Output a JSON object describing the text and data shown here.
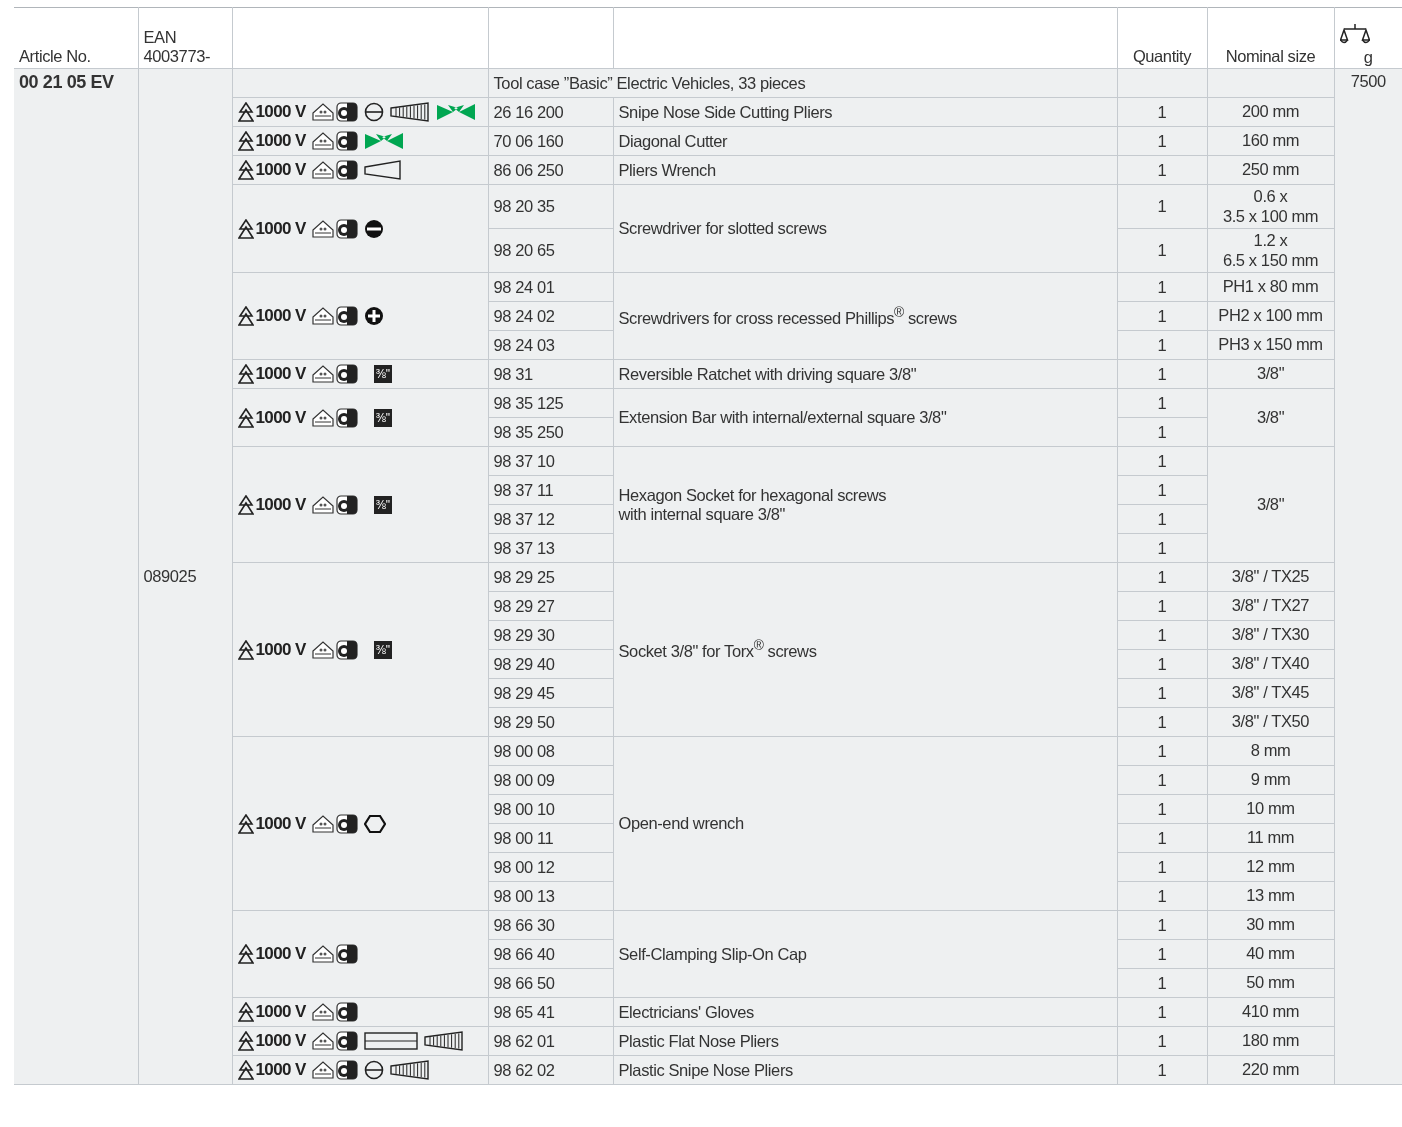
{
  "table": {
    "header": {
      "article_no": "Article No.",
      "ean": "EAN\n4003773-",
      "quantity": "Quantity",
      "nominal_size": "Nominal size",
      "weight_unit": "g"
    },
    "set": {
      "article_no": "00 21 05 EV",
      "ean": "089025",
      "description": "Tool case ”Basic” Electric Vehicles, 33 pieces",
      "weight": "7500"
    },
    "groups": [
      {
        "rating": "1000 V",
        "icons": [
          {
            "kind": "slot"
          },
          {
            "kind": "taper"
          },
          {
            "kind": "cutter"
          }
        ],
        "articles": [
          "26 16 200"
        ],
        "description": "Snipe Nose Side Cutting Pliers",
        "quantities": [
          "1"
        ],
        "sizes": [
          "200 mm"
        ]
      },
      {
        "rating": "1000 V",
        "icons": [
          {
            "kind": "cutter"
          }
        ],
        "articles": [
          "70 06 160"
        ],
        "description": "Diagonal Cutter",
        "quantities": [
          "1"
        ],
        "sizes": [
          "160 mm"
        ]
      },
      {
        "rating": "1000 V",
        "icons": [
          {
            "kind": "jaw"
          }
        ],
        "articles": [
          "86 06 250"
        ],
        "description": "Pliers Wrench",
        "quantities": [
          "1"
        ],
        "sizes": [
          "250 mm"
        ]
      },
      {
        "rating": "1000 V",
        "icons": [
          {
            "kind": "slot-solid"
          }
        ],
        "articles": [
          "98 20 35",
          "98 20 65"
        ],
        "description": "Screwdriver for slotted screws",
        "quantities": [
          "1",
          "1"
        ],
        "sizes": [
          "0.6 x\n3.5 x 100 mm",
          "1.2 x\n6.5 x 150 mm"
        ]
      },
      {
        "rating": "1000 V",
        "icons": [
          {
            "kind": "cross-solid"
          }
        ],
        "articles": [
          "98 24 01",
          "98 24 02",
          "98 24 03"
        ],
        "description": "Screwdrivers for cross recessed Phillips$^{®}$ screws",
        "quantities": [
          "1",
          "1",
          "1"
        ],
        "sizes": [
          "PH1 x 80 mm",
          "PH2 x 100 mm",
          "PH3 x 150 mm"
        ]
      },
      {
        "rating": "1000 V",
        "icons": [
          {
            "kind": "square-drive",
            "label": "⅜\""
          }
        ],
        "articles": [
          "98 31"
        ],
        "description": "Reversible Ratchet with driving square 3/8\"",
        "quantities": [
          "1"
        ],
        "sizes": [
          "3/8\""
        ]
      },
      {
        "rating": "1000 V",
        "icons": [
          {
            "kind": "square-drive",
            "label": "⅜\""
          }
        ],
        "articles": [
          "98 35 125",
          "98 35 250"
        ],
        "description": "Extension Bar with internal/external square 3/8\"",
        "quantities": [
          "1",
          "1"
        ],
        "size": "3/8\""
      },
      {
        "rating": "1000 V",
        "icons": [
          {
            "kind": "square-drive",
            "label": "⅜\""
          }
        ],
        "articles": [
          "98 37 10",
          "98 37 11",
          "98 37 12",
          "98 37 13"
        ],
        "description": "Hexagon Socket for hexagonal screws\nwith internal square 3/8\"",
        "quantities": [
          "1",
          "1",
          "1",
          "1"
        ],
        "size": "3/8\""
      },
      {
        "rating": "1000 V",
        "icons": [
          {
            "kind": "square-drive",
            "label": "⅜\""
          }
        ],
        "articles": [
          "98 29 25",
          "98 29 27",
          "98 29 30",
          "98 29 40",
          "98 29 45",
          "98 29 50"
        ],
        "description": "Socket 3/8\" for Torx$^{®}$ screws",
        "quantities": [
          "1",
          "1",
          "1",
          "1",
          "1",
          "1"
        ],
        "sizes": [
          "3/8\" / TX25",
          "3/8\" / TX27",
          "3/8\" / TX30",
          "3/8\" / TX40",
          "3/8\" / TX45",
          "3/8\" / TX50"
        ]
      },
      {
        "rating": "1000 V",
        "icons": [
          {
            "kind": "hexagon"
          }
        ],
        "articles": [
          "98 00 08",
          "98 00 09",
          "98 00 10",
          "98 00 11",
          "98 00 12",
          "98 00 13"
        ],
        "description": "Open-end wrench",
        "quantities": [
          "1",
          "1",
          "1",
          "1",
          "1",
          "1"
        ],
        "sizes": [
          "8 mm",
          "9 mm",
          "10 mm",
          "11 mm",
          "12 mm",
          "13 mm"
        ]
      },
      {
        "rating": "1000 V",
        "articles": [
          "98 66 30",
          "98 66 40",
          "98 66 50"
        ],
        "description": "Self-Clamping Slip-On Cap",
        "quantities": [
          "1",
          "1",
          "1"
        ],
        "sizes": [
          "30 mm",
          "40 mm",
          "50 mm"
        ]
      },
      {
        "rating": "1000 V",
        "articles": [
          "98 65 41"
        ],
        "description": "Electricians' Gloves",
        "quantities": [
          "1"
        ],
        "sizes": [
          "410 mm"
        ]
      },
      {
        "rating": "1000 V",
        "icons": [
          {
            "kind": "flat"
          },
          {
            "kind": "taper"
          }
        ],
        "articles": [
          "98 62 01"
        ],
        "description": "Plastic Flat Nose Pliers",
        "quantities": [
          "1"
        ],
        "sizes": [
          "180 mm"
        ]
      },
      {
        "rating": "1000 V",
        "icons": [
          {
            "kind": "slot"
          },
          {
            "kind": "taper"
          }
        ],
        "articles": [
          "98 62 02"
        ],
        "description": "Plastic Snipe Nose Pliers",
        "quantities": [
          "1"
        ],
        "sizes": [
          "220 mm"
        ]
      }
    ]
  }
}
